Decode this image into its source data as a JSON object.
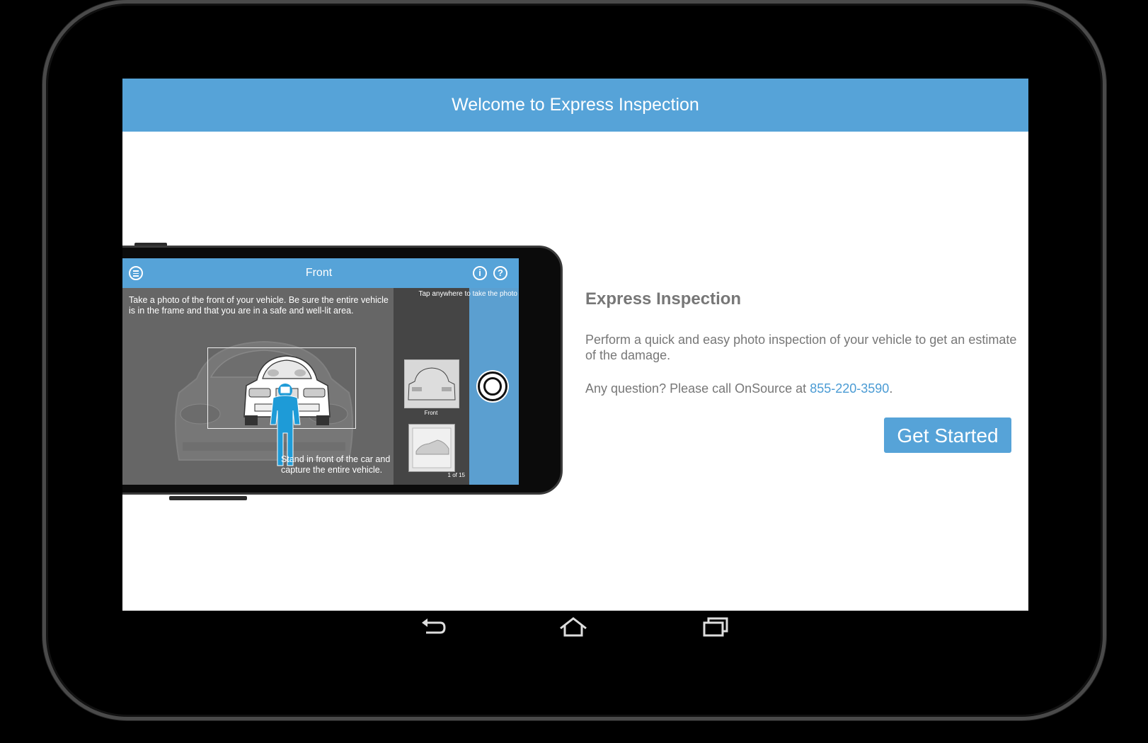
{
  "app_bar": {
    "title": "Welcome to Express Inspection"
  },
  "illustration": {
    "screen_title": "Front",
    "instruction": "Take a photo of the front of your vehicle. Be sure the entire vehicle is in the frame and that you are in a safe and well-lit area.",
    "tap_hint": "Tap anywhere to take the photo",
    "bottom_hint": "Stand in front of the car and capture the entire vehicle.",
    "thumb_label": "Front",
    "counter": "1 of 15",
    "info_icon_glyph": "i",
    "help_icon_glyph": "?"
  },
  "content": {
    "title": "Express Inspection",
    "description": "Perform a quick and easy photo inspection of your vehicle to get an estimate of the damage.",
    "call_prefix": "Any question? Please call OnSource at ",
    "phone_number": "855-220-3590",
    "call_suffix": ".",
    "button_label": "Get Started"
  },
  "colors": {
    "accent": "#56a3d8",
    "link": "#4a9bd4",
    "text_gray": "#777777"
  },
  "nav_icons": [
    "back-icon",
    "home-icon",
    "recents-icon"
  ]
}
